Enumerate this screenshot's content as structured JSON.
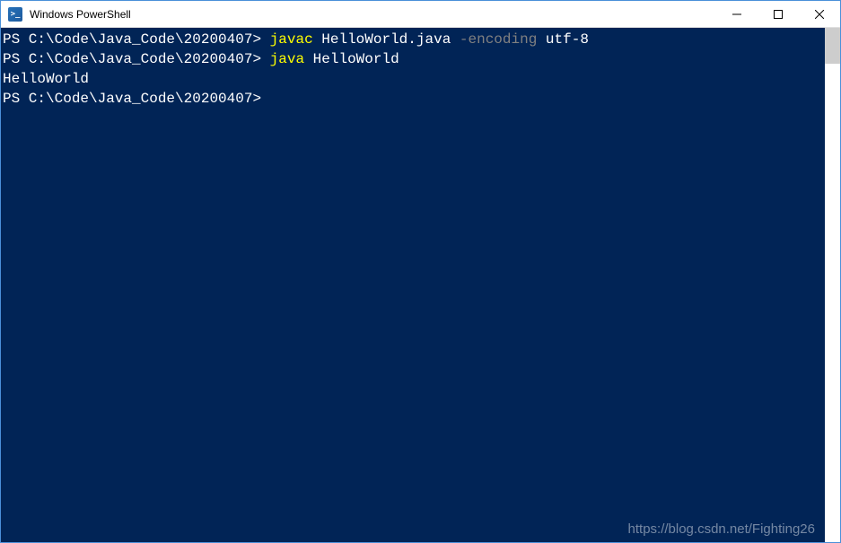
{
  "window": {
    "title": "Windows PowerShell",
    "icon_label": ">_"
  },
  "terminal": {
    "lines": [
      {
        "prompt": "PS C:\\Code\\Java_Code\\20200407> ",
        "segments": [
          {
            "text": "javac ",
            "cls": "cmd-yellow"
          },
          {
            "text": "HelloWorld.java ",
            "cls": "cmd-white"
          },
          {
            "text": "-encoding ",
            "cls": "cmd-gray"
          },
          {
            "text": "utf-8",
            "cls": "cmd-white"
          }
        ]
      },
      {
        "prompt": "PS C:\\Code\\Java_Code\\20200407> ",
        "segments": [
          {
            "text": "java ",
            "cls": "cmd-yellow"
          },
          {
            "text": "HelloWorld",
            "cls": "cmd-white"
          }
        ]
      },
      {
        "output": "HelloWorld"
      },
      {
        "prompt": "PS C:\\Code\\Java_Code\\20200407> ",
        "segments": []
      }
    ]
  },
  "watermark": "https://blog.csdn.net/Fighting26"
}
